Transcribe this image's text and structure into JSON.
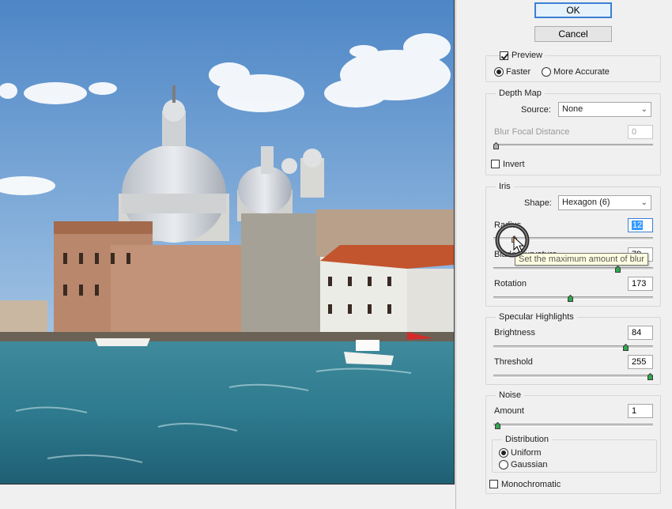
{
  "buttons": {
    "ok": "OK",
    "cancel": "Cancel"
  },
  "preview_options": {
    "preview_label": "Preview",
    "preview_checked": true,
    "faster_label": "Faster",
    "more_accurate_label": "More Accurate",
    "selected_mode": "Faster"
  },
  "depth_map": {
    "title": "Depth Map",
    "source_label": "Source:",
    "source_value": "None",
    "blur_focal_label": "Blur Focal Distance",
    "blur_focal_value": "0",
    "blur_focal_level": 0.0,
    "invert_label": "Invert",
    "invert_checked": false
  },
  "iris": {
    "title": "Iris",
    "shape_label": "Shape:",
    "shape_value": "Hexagon (6)",
    "radius_label": "Radius",
    "radius_value": "12",
    "radius_level": 0.12,
    "blade_label": "Blade Curvature",
    "blade_value": "79",
    "blade_level": 0.79,
    "rotation_label": "Rotation",
    "rotation_value": "173",
    "rotation_level": 0.48
  },
  "specular": {
    "title": "Specular Highlights",
    "brightness_label": "Brightness",
    "brightness_value": "84",
    "brightness_level": 0.84,
    "threshold_label": "Threshold",
    "threshold_value": "255",
    "threshold_level": 1.0
  },
  "noise": {
    "title": "Noise",
    "amount_label": "Amount",
    "amount_value": "1",
    "amount_level": 0.01,
    "distribution_title": "Distribution",
    "uniform_label": "Uniform",
    "gaussian_label": "Gaussian",
    "selected_distribution": "Uniform",
    "mono_label": "Monochromatic",
    "mono_checked": false
  },
  "tooltip": "Set the maximum amount of blur",
  "icons": {
    "cursor": "pointer-cursor-icon",
    "dropdown": "chevron-down-icon"
  },
  "colors": {
    "accent": "#3c7fd4",
    "selection": "#3399ff",
    "thumb_green": "#2fa84f"
  }
}
